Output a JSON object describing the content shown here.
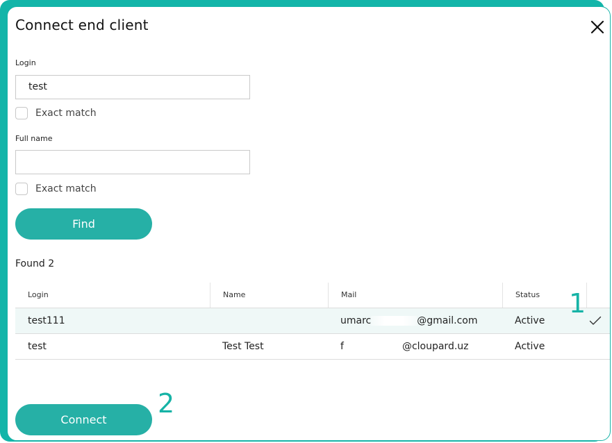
{
  "dialog": {
    "title": "Connect end client",
    "close_icon": "close-icon"
  },
  "form": {
    "login_label": "Login",
    "login_value": "test",
    "login_exact_label": "Exact match",
    "fullname_label": "Full name",
    "fullname_value": "",
    "fullname_exact_label": "Exact match",
    "find_label": "Find"
  },
  "results": {
    "found_text": "Found 2",
    "columns": [
      "Login",
      "Name",
      "Mail",
      "Status"
    ],
    "rows": [
      {
        "login": "test111",
        "name": "",
        "mail_visible_start": "umarc",
        "mail_visible_end": "@gmail.com",
        "status": "Active",
        "selected": true
      },
      {
        "login": "test",
        "name": "Test Test",
        "mail_visible_start": "f",
        "mail_visible_end": "@cloupard.uz",
        "status": "Active",
        "selected": false
      }
    ]
  },
  "footer": {
    "connect_label": "Connect"
  },
  "annotations": {
    "marker_1": "1",
    "marker_2": "2"
  },
  "colors": {
    "accent": "#26b0a6",
    "frame": "#13b5a9",
    "selected_row": "#eff8f7"
  }
}
